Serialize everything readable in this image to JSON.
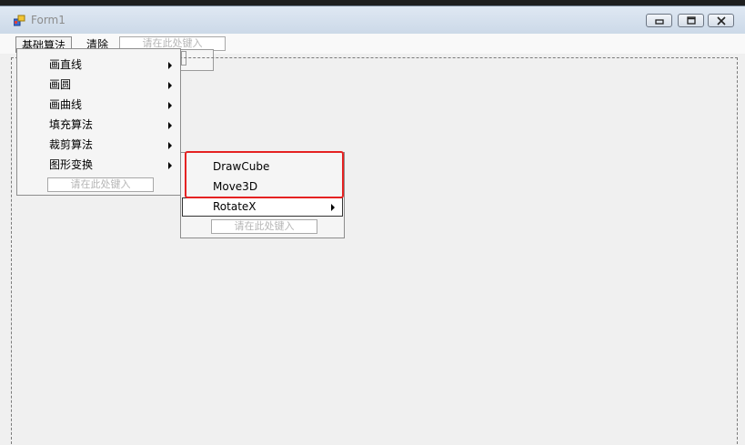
{
  "window": {
    "title": "Form1",
    "icon": "winforms-app-icon"
  },
  "titlebar_buttons": {
    "minimize": "minimize-icon",
    "maximize": "maximize-icon",
    "close": "close-icon"
  },
  "menubar": {
    "items": [
      {
        "label": "基础算法",
        "open": true
      },
      {
        "label": "清除"
      }
    ],
    "type_here": "请在此处键入"
  },
  "dropdown": {
    "items": [
      {
        "label": "画直线"
      },
      {
        "label": "画圆"
      },
      {
        "label": "画曲线"
      },
      {
        "label": "填充算法"
      },
      {
        "label": "裁剪算法"
      },
      {
        "label": "图形变换"
      }
    ],
    "type_here": "请在此处键入"
  },
  "submenu": {
    "items": [
      {
        "label": "DrawCube"
      },
      {
        "label": "Move3D"
      },
      {
        "label": "RotateX",
        "hovered": true
      }
    ],
    "type_here": "请在此处键入"
  },
  "colors": {
    "annotation": "#e52222",
    "menu_bg": "#f5f5f5",
    "window_bg": "#f0f0f0"
  }
}
